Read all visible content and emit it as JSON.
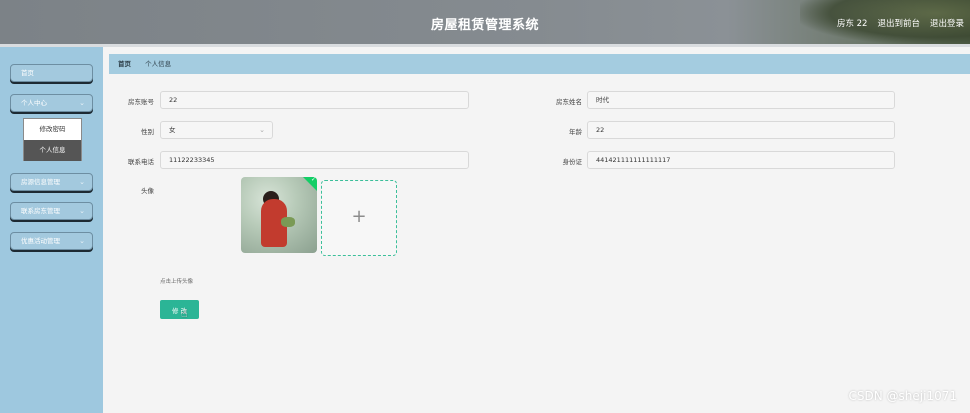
{
  "header": {
    "title": "房屋租赁管理系统",
    "user_label": "房东 22",
    "back_to_front": "退出到前台",
    "logout": "退出登录"
  },
  "sidebar": {
    "items": [
      {
        "label": "首页"
      },
      {
        "label": "个人中心",
        "chevron": "chevron-down-icon"
      },
      {
        "label": "房源信息管理",
        "chevron": "chevron-down-icon"
      },
      {
        "label": "联系房东管理",
        "chevron": "chevron-down-icon"
      },
      {
        "label": "优惠活动管理",
        "chevron": "chevron-down-icon"
      }
    ],
    "submenu": [
      {
        "label": "修改密码"
      },
      {
        "label": "个人信息",
        "active": true
      }
    ]
  },
  "breadcrumb": {
    "home": "首页",
    "current": "个人信息"
  },
  "form": {
    "account_label": "房东账号",
    "account_value": "22",
    "name_label": "房东姓名",
    "name_value": "时代",
    "gender_label": "性别",
    "gender_value": "女",
    "age_label": "年龄",
    "age_value": "22",
    "phone_label": "联系电话",
    "phone_value": "11122233345",
    "id_label": "身份证",
    "id_value": "441421111111111117",
    "avatar_label": "头像",
    "upload_plus": "+",
    "upload_hint": "点击上传头像",
    "submit_label": "修 改"
  },
  "watermark": "CSDN @sheji1071",
  "colors": {
    "sidebar": "#9ec8df",
    "accent": "#2bb596",
    "breadcrumb": "#a4cce0"
  }
}
